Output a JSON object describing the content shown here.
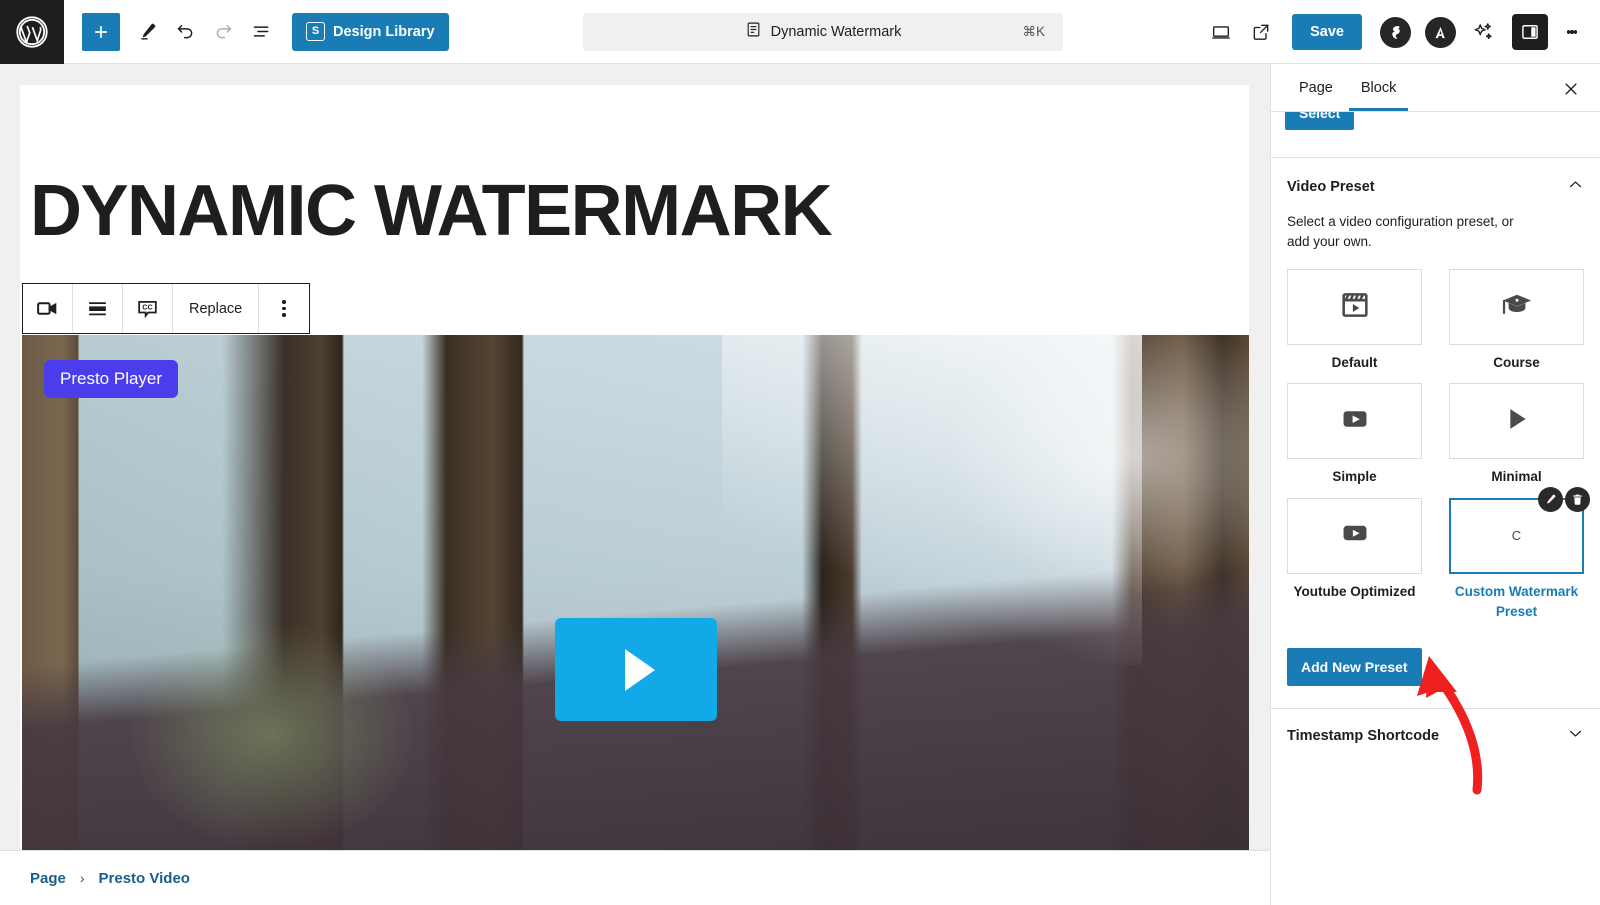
{
  "topbar": {
    "logo_icon": "wordpress-logo-icon",
    "add_block_icon": "plus-icon",
    "edit_tool_icon": "pencil-icon",
    "undo_icon": "undo-arrow-icon",
    "redo_icon": "redo-arrow-icon",
    "list_view_icon": "document-outline-icon",
    "design_library_label": "Design Library",
    "design_library_badge": "S",
    "command_bar": {
      "icon": "page-document-icon",
      "title": "Dynamic Watermark",
      "shortcut": "⌘K"
    },
    "preview_icon": "desktop-preview-icon",
    "view_external_icon": "external-link-icon",
    "save_label": "Save",
    "plugin_icon_1": "bolt-circle-icon",
    "plugin_icon_2": "analytics-circle-icon",
    "ai_icon": "sparkles-icon",
    "sidebar_toggle_icon": "settings-panel-icon",
    "options_icon": "kebab-menu-icon"
  },
  "editor": {
    "post_title": "DYNAMIC WATERMARK",
    "block_toolbar": {
      "block_type_icon": "video-camera-icon",
      "align_icon": "align-full-width-icon",
      "captions_icon": "closed-captions-icon",
      "replace_label": "Replace",
      "more_icon": "kebab-menu-icon"
    },
    "video": {
      "badge_label": "Presto Player",
      "play_icon": "play-triangle-icon"
    },
    "breadcrumb": {
      "separator": "›",
      "items": [
        "Page",
        "Presto Video"
      ]
    }
  },
  "sidebar": {
    "tabs": [
      {
        "label": "Page",
        "active": false
      },
      {
        "label": "Block",
        "active": true
      }
    ],
    "close_icon": "close-x-icon",
    "select_label": "Select",
    "video_preset_panel": {
      "title": "Video Preset",
      "collapse_icon": "chevron-up-icon",
      "description": "Select a video configuration preset, or add your own.",
      "presets": [
        {
          "label": "Default",
          "icon": "film-play-icon",
          "selected": false,
          "thumb_text": ""
        },
        {
          "label": "Course",
          "icon": "graduation-cap-icon",
          "selected": false,
          "thumb_text": ""
        },
        {
          "label": "Simple",
          "icon": "play-box-icon",
          "selected": false,
          "thumb_text": ""
        },
        {
          "label": "Minimal",
          "icon": "play-triangle-icon",
          "selected": false,
          "thumb_text": ""
        },
        {
          "label": "Youtube Optimized",
          "icon": "youtube-play-icon",
          "selected": false,
          "thumb_text": ""
        },
        {
          "label": "Custom Watermark Preset",
          "icon": "",
          "selected": true,
          "thumb_text": "C"
        }
      ],
      "edit_preset_icon": "pencil-edit-icon",
      "delete_preset_icon": "trash-icon",
      "add_preset_label": "Add New Preset"
    },
    "timestamp_panel": {
      "title": "Timestamp Shortcode",
      "expand_icon": "chevron-down-icon"
    }
  },
  "annotation": {
    "arrow_color": "#ef2020",
    "name": "red-arrow-annotation"
  },
  "colors": {
    "accent_blue": "#1a7cb5",
    "presto_purple": "#4b3dec",
    "play_cyan": "#11a9e8",
    "dark": "#1e1e1e"
  }
}
